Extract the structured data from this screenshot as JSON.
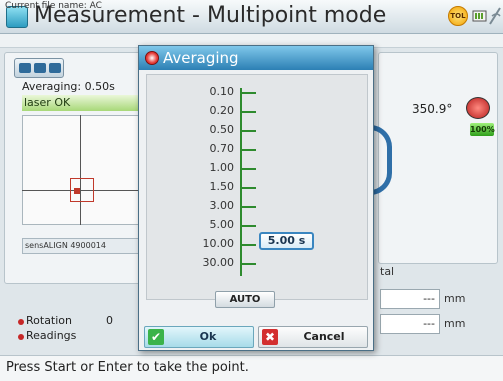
{
  "window": {
    "title": "Measurement - Multipoint mode",
    "tol_badge": "TOL"
  },
  "info": {
    "file_name_label": "Current file name: AC"
  },
  "left_panel": {
    "averaging": "Averaging: 0.50s",
    "laser_status": "laser OK",
    "sensor_id": "sensALIGN 4900014"
  },
  "right_panel": {
    "angle": "350.9°",
    "quality": "100%",
    "total_label": "tal",
    "readout_1": "---",
    "readout_2": "---",
    "unit": "mm"
  },
  "bottom": {
    "rotation_label": "Rotation",
    "rotation_value": "0",
    "readings_label": "Readings",
    "status_text": "Press Start or Enter to take the point."
  },
  "dialog": {
    "title": "Averaging",
    "options": [
      "0.10",
      "0.20",
      "0.50",
      "0.70",
      "1.00",
      "1.50",
      "3.00",
      "5.00",
      "10.00",
      "30.00"
    ],
    "selected_value": "5.00 s",
    "auto_label": "AUTO",
    "ok_label": "Ok",
    "cancel_label": "Cancel"
  },
  "colors": {
    "accent": "#2c7fb4",
    "scale_green": "#2e8b2e",
    "ok_green": "#3bb34a",
    "cancel_red": "#d32f2f",
    "laser_ok_green": "#a8d878"
  },
  "icons": {
    "app": "multipoint-app-icon",
    "tol": "tolerance-icon",
    "battery": "battery-icon",
    "signal": "signal-icon",
    "dialog": "averaging-icon",
    "ok": "checkmark-icon",
    "cancel": "close-icon",
    "angle": "inclinometer-icon"
  }
}
